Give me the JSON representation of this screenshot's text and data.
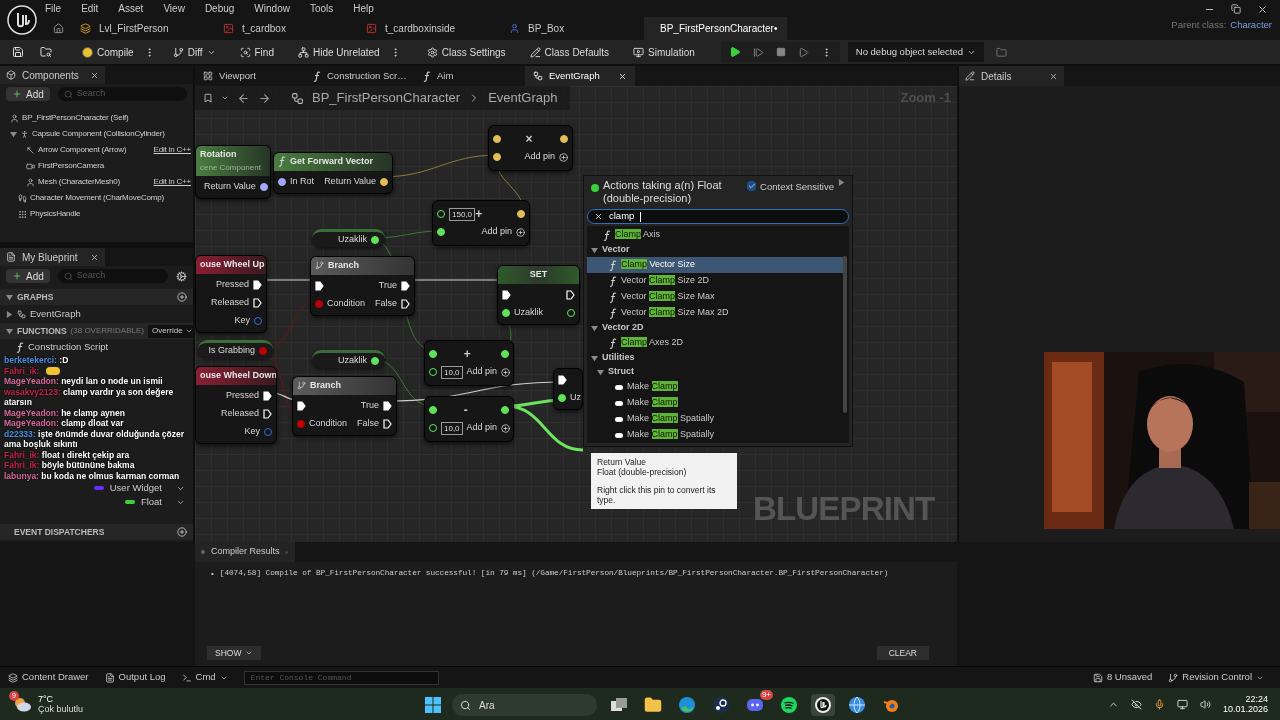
{
  "menu": [
    "File",
    "Edit",
    "Asset",
    "View",
    "Debug",
    "Window",
    "Tools",
    "Help"
  ],
  "doc_tabs": [
    {
      "label": "Lvl_FirstPerson",
      "kind": "level",
      "selected": false
    },
    {
      "label": "t_cardbox",
      "kind": "texture",
      "selected": false
    },
    {
      "label": "t_cardboxinside",
      "kind": "texture",
      "selected": false
    },
    {
      "label": "BP_Box",
      "kind": "blueprint",
      "selected": false
    },
    {
      "label": "BP_FirstPersonCharacter•",
      "kind": "blueprint",
      "selected": true
    }
  ],
  "parent_class": {
    "label": "Parent class:",
    "value": "Character"
  },
  "toolbar": {
    "buttons": [
      {
        "label": "Compile",
        "kind": "compile"
      },
      {
        "label": "Diff",
        "kind": "diff"
      },
      {
        "label": "Find",
        "kind": "find"
      },
      {
        "label": "Hide Unrelated",
        "kind": "hide"
      },
      {
        "label": "Class Settings",
        "kind": "settings"
      },
      {
        "label": "Class Defaults",
        "kind": "defaults"
      },
      {
        "label": "Simulation",
        "kind": "simulation"
      }
    ],
    "debug_object": "No debug object selected"
  },
  "components": {
    "title": "Components",
    "add": "Add",
    "search_placeholder": "Search",
    "tree": [
      {
        "label": "BP_FirstPersonCharacter (Self)",
        "kind": "self",
        "children": [
          {
            "label": "Capsule Component (CollisionCylinder)",
            "kind": "capsule",
            "children": [
              {
                "label": "Arrow Component (Arrow)",
                "kind": "arrow",
                "link": "Edit in C++"
              },
              {
                "label": "FirstPersonCamera",
                "kind": "camera"
              },
              {
                "label": "Mesh (CharacterMesh0)",
                "kind": "mesh",
                "link": "Edit in C++"
              }
            ]
          },
          {
            "label": "Character Movement (CharMoveComp)",
            "kind": "movement"
          },
          {
            "label": "PhysicsHandle",
            "kind": "physics"
          }
        ]
      }
    ]
  },
  "my_blueprint": {
    "title": "My Blueprint",
    "add": "Add",
    "search_placeholder": "Search",
    "graphs": {
      "title": "GRAPHS",
      "items": [
        "EventGraph"
      ]
    },
    "functions": {
      "title": "FUNCTIONS",
      "note": "(38 OVERRIDABLE)",
      "dropdown": "Override",
      "items": [
        "Construction Script"
      ]
    },
    "variables": [
      {
        "label": "User Widget",
        "color": "#6a2cff"
      },
      {
        "label": "Float",
        "color": "#3fd13a"
      }
    ],
    "dispatchers": "EVENT DISPATCHERS"
  },
  "chat": [
    {
      "user": "berketekerci:",
      "color": "#4a8fe0",
      "text": ":D"
    },
    {
      "user": "Fahri_ik:",
      "color": "#c0204a",
      "emote": true
    },
    {
      "user": "MageYeadon:",
      "color": "#d86a9a",
      "text": "neydi lan o node un ismii"
    },
    {
      "user": "wasakvy2123:",
      "color": "#c0204a",
      "text": "clamp vardır ya son değere atarsın"
    },
    {
      "user": "MageYeadon:",
      "color": "#d86a9a",
      "text": "he clamp aynen"
    },
    {
      "user": "MageYeadon:",
      "color": "#d86a9a",
      "text": "clamp dloat var"
    },
    {
      "user": "d22333:",
      "color": "#4a8fe0",
      "text": "işte önümde duvar olduğunda çözer ama boşluk sıkıntı"
    },
    {
      "user": "Fahri_ik:",
      "color": "#c0204a",
      "text": "float ı direkt çekip ara"
    },
    {
      "user": "Fahri_ik:",
      "color": "#c0204a",
      "text": "böyle bütününe bakma"
    },
    {
      "user": "labunya:",
      "color": "#d86a9a",
      "text": "bu koda ne olmus karman corman"
    }
  ],
  "graph_tabs": [
    {
      "label": "Viewport",
      "kind": "viewport",
      "selected": false
    },
    {
      "label": "Construction Scr…",
      "kind": "function",
      "selected": false
    },
    {
      "label": "Aim",
      "kind": "function",
      "selected": false
    },
    {
      "label": "EventGraph",
      "kind": "graph",
      "selected": true
    }
  ],
  "graph": {
    "breadcrumb": [
      "BP_FirstPersonCharacter",
      "EventGraph"
    ],
    "zoom": "Zoom -1",
    "watermark": "BLUEPRINT",
    "nodes": [
      {
        "kind": "function",
        "title": "Rotation",
        "subtitle": "cene Component",
        "outputs": [
          {
            "label": "Return Value",
            "kind": "rotator",
            "linked": true
          }
        ]
      },
      {
        "kind": "function",
        "title": "Get Forward Vector",
        "inputs": [
          {
            "label": "In Rot",
            "kind": "rotator",
            "linked": true
          }
        ],
        "outputs": [
          {
            "label": "Return Value",
            "kind": "vector",
            "linked": true
          }
        ]
      },
      {
        "kind": "math",
        "op": "×",
        "add_pin": "Add pin",
        "inputs": [
          {
            "kind": "vector",
            "linked": true
          },
          {
            "kind": "vector",
            "linked": true
          }
        ],
        "outputs": [
          {
            "kind": "vector",
            "linked": true
          }
        ]
      },
      {
        "kind": "math",
        "op": "+",
        "add_pin": "Add pin",
        "inputs": [
          {
            "kind": "float",
            "linked": false,
            "value": "150,0"
          },
          {
            "kind": "float",
            "linked": true
          }
        ],
        "outputs": [
          {
            "kind": "vector",
            "linked": true
          }
        ]
      },
      {
        "kind": "getter",
        "title": "Uzaklik",
        "pin": {
          "kind": "float",
          "linked": true
        }
      },
      {
        "kind": "event",
        "title": "ouse Wheel Up",
        "outputs": [
          {
            "label": "Pressed",
            "kind": "exec",
            "linked": true
          },
          {
            "label": "Released",
            "kind": "exec",
            "linked": false
          },
          {
            "label": "Key",
            "kind": "key",
            "linked": false
          }
        ]
      },
      {
        "kind": "branch",
        "title": "Branch",
        "inputs": [
          {
            "kind": "exec",
            "linked": true
          },
          {
            "label": "Condition",
            "kind": "bool",
            "linked": true
          }
        ],
        "outputs": [
          {
            "label": "True",
            "kind": "exec",
            "linked": true
          },
          {
            "label": "False",
            "kind": "exec",
            "linked": false
          }
        ]
      },
      {
        "kind": "set",
        "title": "SET",
        "inputs": [
          {
            "kind": "exec",
            "linked": true
          },
          {
            "label": "Uzaklik",
            "kind": "float",
            "linked": true
          }
        ],
        "outputs": [
          {
            "kind": "exec",
            "linked": false
          },
          {
            "kind": "float",
            "linked": false
          }
        ]
      },
      {
        "kind": "getter",
        "title": "Is Grabbing",
        "pin": {
          "kind": "bool",
          "linked": true
        }
      },
      {
        "kind": "getter",
        "title": "Uzaklik",
        "pin": {
          "kind": "float",
          "linked": true
        }
      },
      {
        "kind": "math",
        "op": "+",
        "add_pin": "Add pin",
        "inputs": [
          {
            "kind": "float",
            "linked": true
          },
          {
            "kind": "float",
            "linked": false,
            "value": "10,0"
          }
        ],
        "outputs": [
          {
            "kind": "float",
            "linked": true
          }
        ]
      },
      {
        "kind": "event",
        "title": "ouse Wheel Down",
        "outputs": [
          {
            "label": "Pressed",
            "kind": "exec",
            "linked": true
          },
          {
            "label": "Released",
            "kind": "exec",
            "linked": false
          },
          {
            "label": "Key",
            "kind": "key",
            "linked": false
          }
        ]
      },
      {
        "kind": "branch",
        "title": "Branch",
        "inputs": [
          {
            "kind": "exec",
            "linked": true
          },
          {
            "label": "Condition",
            "kind": "bool",
            "linked": true
          }
        ],
        "outputs": [
          {
            "label": "True",
            "kind": "exec",
            "linked": true
          },
          {
            "label": "False",
            "kind": "exec",
            "linked": false
          }
        ]
      },
      {
        "kind": "math",
        "op": "-",
        "add_pin": "Add pin",
        "inputs": [
          {
            "kind": "float",
            "linked": true
          },
          {
            "kind": "float",
            "linked": false,
            "value": "10,0"
          }
        ],
        "outputs": [
          {
            "kind": "float",
            "linked": true
          }
        ]
      },
      {
        "kind": "set",
        "inputs": [
          {
            "kind": "exec",
            "linked": true
          },
          {
            "label": "Uz",
            "kind": "float",
            "linked": true
          }
        ]
      }
    ],
    "action_menu": {
      "title": "Actions taking a(n) Float (double-precision)",
      "context_label": "Context Sensitive",
      "context_sensitive": true,
      "search": "clamp",
      "items": [
        {
          "kind": "function",
          "match": "Clamp",
          "after": " Axis",
          "selected": false
        },
        {
          "kind": "category",
          "label": "Vector",
          "children": [
            {
              "kind": "function",
              "match": "Clamp",
              "after": " Vector Size",
              "selected": true
            },
            {
              "kind": "function",
              "before": "Vector ",
              "match": "Clamp",
              "after": " Size 2D",
              "selected": false
            },
            {
              "kind": "function",
              "before": "Vector ",
              "match": "Clamp",
              "after": " Size Max",
              "selected": false
            },
            {
              "kind": "function",
              "before": "Vector ",
              "match": "Clamp",
              "after": " Size Max 2D",
              "selected": false
            }
          ]
        },
        {
          "kind": "category",
          "label": "Vector 2D",
          "children": [
            {
              "kind": "function",
              "match": "Clamp",
              "after": " Axes 2D",
              "selected": false
            }
          ]
        },
        {
          "kind": "category",
          "label": "Utilities",
          "children": [
            {
              "kind": "category",
              "label": "Struct",
              "children": [
                {
                  "kind": "struct",
                  "before": "Make ",
                  "match": "Clamp",
                  "selected": false
                },
                {
                  "kind": "struct",
                  "before": "Make ",
                  "match": "Clamp",
                  "selected": false
                },
                {
                  "kind": "struct",
                  "before": "Make ",
                  "match": "Clamp",
                  "after": " Spatially",
                  "selected": false
                },
                {
                  "kind": "struct",
                  "before": "Make ",
                  "match": "Clamp",
                  "after": " Spatially",
                  "selected": false
                }
              ]
            }
          ]
        }
      ]
    },
    "tooltip": [
      "Return Value",
      "Float (double-precision)",
      "Right click this pin to convert its type."
    ]
  },
  "details": {
    "title": "Details"
  },
  "compiler": {
    "title": "Compiler Results",
    "marker": "•",
    "messages": [
      "[4074,58] Compile of BP_FirstPersonCharacter successful! [in 79 ms] (/Game/FirstPerson/Blueprints/BP_FirstPersonCharacter.BP_FirstPersonCharacter)"
    ],
    "show": "SHOW",
    "clear": "CLEAR"
  },
  "status_bar": {
    "content_drawer": "Content Drawer",
    "output_log": "Output Log",
    "cmd": "Cmd",
    "console_placeholder": "Enter Console Command",
    "unsaved": "8 Unsaved",
    "revision": "Revision Control"
  },
  "taskbar": {
    "weather": {
      "badge": "9",
      "temp": "7°C",
      "condition": "Çok bulutlu"
    },
    "search_placeholder": "Ara",
    "apps": [
      {
        "kind": "taskview",
        "selected": false
      },
      {
        "kind": "explorer",
        "selected": false
      },
      {
        "kind": "edge",
        "selected": false
      },
      {
        "kind": "steam",
        "selected": false
      },
      {
        "kind": "discord",
        "badge": "9+",
        "selected": false
      },
      {
        "kind": "spotify",
        "selected": false
      },
      {
        "kind": "unreal",
        "selected": true
      },
      {
        "kind": "globe",
        "selected": false
      },
      {
        "kind": "blender",
        "selected": false
      }
    ],
    "time": "22:24",
    "date": "10.01.2026"
  },
  "webcam": {
    "kind": "picture"
  }
}
